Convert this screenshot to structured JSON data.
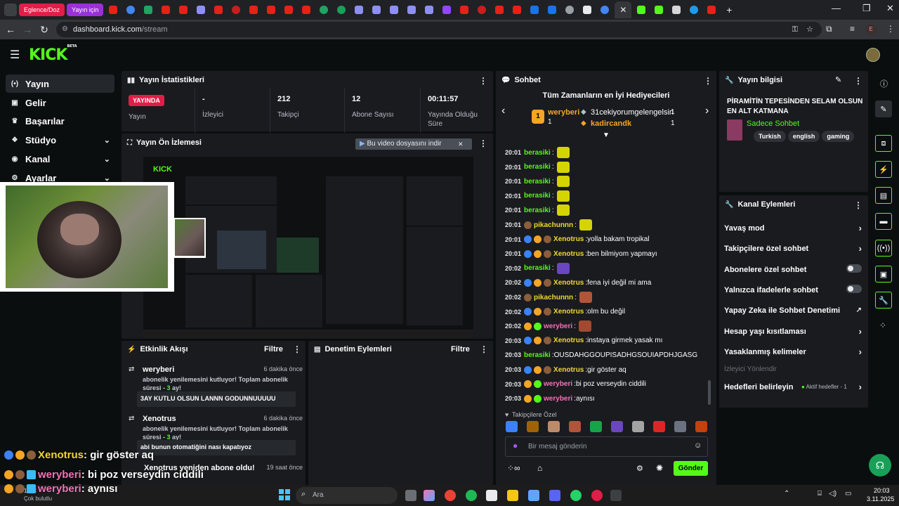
{
  "browser": {
    "tabs": [
      {
        "label": "Eglence/Doz",
        "color": "#e11d48"
      },
      {
        "label": "Yayın için",
        "color": "#9b30d9"
      }
    ],
    "url_host": "dashboard.kick.com",
    "url_path": "/stream",
    "profile_initial": "E"
  },
  "brand": {
    "logo": "KICK",
    "logo_sup": "BETA",
    "accent": "#53fc18"
  },
  "sidebar": {
    "items": [
      {
        "label": "Yayın",
        "icon": "broadcast-icon",
        "glyph": "(•)"
      },
      {
        "label": "Gelir",
        "icon": "revenue-icon",
        "glyph": "▣"
      },
      {
        "label": "Başarılar",
        "icon": "trophy-icon",
        "glyph": "♛"
      },
      {
        "label": "Stüdyo",
        "icon": "studio-icon",
        "glyph": "❖"
      },
      {
        "label": "Kanal",
        "icon": "channel-icon",
        "glyph": "◉"
      },
      {
        "label": "Ayarlar",
        "icon": "settings-icon",
        "glyph": "⚙"
      }
    ]
  },
  "stats": {
    "title": "Yayın İstatistikleri",
    "live_badge": "YAYINDA",
    "live_label": "Yayın",
    "viewers_val": "-",
    "viewers_lbl": "İzleyici",
    "followers_val": "212",
    "followers_lbl": "Takipçi",
    "subs_val": "12",
    "subs_lbl": "Abone Sayısı",
    "uptime_val": "00:11:57",
    "uptime_lbl": "Yayında Olduğu Süre"
  },
  "preview": {
    "title": "Yayın Ön İzlemesi",
    "download_banner": "Bu video dosyasını indir"
  },
  "feed": {
    "title": "Etkinlik Akışı",
    "filter": "Filtre",
    "items": [
      {
        "name": "weryberi",
        "time": "6 dakika önce",
        "msg_a": "abonelik yenilemesini kutluyor! Toplam abonelik süresi - ",
        "msg_num": "3",
        "msg_b": " ay!",
        "quote": "3AY KUTLU OLSUN LANNN GODUNNUUUUU"
      },
      {
        "name": "Xenotrus",
        "time": "6 dakika önce",
        "msg_a": "abonelik yenilemesini kutluyor! Toplam abonelik süresi - ",
        "msg_num": "3",
        "msg_b": " ay!",
        "quote": "abi bunun otomatiğini nası kapatıyoz"
      },
      {
        "name": "Xenotrus yeniden abone oldu!",
        "time": "19 saat önce"
      }
    ]
  },
  "moderation": {
    "title": "Denetim Eylemleri",
    "filter": "Filtre"
  },
  "chat": {
    "title": "Sohbet",
    "gifters_title": "Tüm Zamanların en İyi Hediyecileri",
    "gifters": [
      {
        "rank": "1",
        "name": "weryberi",
        "count": "1"
      },
      {
        "rank": "2",
        "name": "31cekiyorumgelengelsin",
        "count": "1"
      },
      {
        "rank": "3",
        "name": "kadircandk",
        "count": "1"
      }
    ],
    "messages": [
      {
        "time": "20:01",
        "user": "berasiki",
        "color": "#53fc18",
        "text": "",
        "emote": "#d4d400",
        "badges": []
      },
      {
        "time": "20:01",
        "user": "berasiki",
        "color": "#53fc18",
        "text": "",
        "emote": "#d4d400",
        "badges": []
      },
      {
        "time": "20:01",
        "user": "berasiki",
        "color": "#53fc18",
        "text": "",
        "emote": "#d4d400",
        "badges": []
      },
      {
        "time": "20:01",
        "user": "berasiki",
        "color": "#53fc18",
        "text": "",
        "emote": "#d4d400",
        "badges": []
      },
      {
        "time": "20:01",
        "user": "berasiki",
        "color": "#53fc18",
        "text": "",
        "emote": "#d4d400",
        "badges": []
      },
      {
        "time": "20:01",
        "user": "pikachunnn",
        "color": "#f0d832",
        "text": "",
        "emote": "#d4d400",
        "badges": [
          "#8b5e3c"
        ]
      },
      {
        "time": "20:01",
        "user": "Xenotrus",
        "color": "#f0d832",
        "text": "yolla bakam tropikal",
        "emote": "",
        "badges": [
          "#3b82f6",
          "#f5a524",
          "#8b5e3c"
        ]
      },
      {
        "time": "20:01",
        "user": "Xenotrus",
        "color": "#f0d832",
        "text": "ben bilmiyom yapmayı",
        "emote": "",
        "badges": [
          "#3b82f6",
          "#f5a524",
          "#8b5e3c"
        ]
      },
      {
        "time": "20:02",
        "user": "berasiki",
        "color": "#53fc18",
        "text": "",
        "emote": "#6b46c1",
        "badges": []
      },
      {
        "time": "20:02",
        "user": "Xenotrus",
        "color": "#f0d832",
        "text": "fena iyi değil mi ama",
        "emote": "",
        "badges": [
          "#3b82f6",
          "#f5a524",
          "#8b5e3c"
        ]
      },
      {
        "time": "20:02",
        "user": "pikachunnn",
        "color": "#f0d832",
        "text": "",
        "emote": "#b0553a",
        "badges": [
          "#8b5e3c"
        ]
      },
      {
        "time": "20:02",
        "user": "Xenotrus",
        "color": "#f0d832",
        "text": "olm bu değil",
        "emote": "",
        "badges": [
          "#3b82f6",
          "#f5a524",
          "#8b5e3c"
        ]
      },
      {
        "time": "20:02",
        "user": "weryberi",
        "color": "#f472b6",
        "text": "",
        "emote": "#a14a30",
        "badges": [
          "#f5a524",
          "#53fc18"
        ]
      },
      {
        "time": "20:03",
        "user": "Xenotrus",
        "color": "#f0d832",
        "text": "instaya girmek yasak mı",
        "emote": "",
        "badges": [
          "#3b82f6",
          "#f5a524",
          "#8b5e3c"
        ]
      },
      {
        "time": "20:03",
        "user": "berasiki",
        "color": "#53fc18",
        "text": "OUSDAHGGOUPISADHGSOUIAPDHJGASG",
        "emote": "",
        "badges": []
      },
      {
        "time": "20:03",
        "user": "Xenotrus",
        "color": "#f0d832",
        "text": "gir göster aq",
        "emote": "",
        "badges": [
          "#3b82f6",
          "#f5a524",
          "#8b5e3c"
        ]
      },
      {
        "time": "20:03",
        "user": "weryberi",
        "color": "#f472b6",
        "text": "bi poz verseydin ciddili",
        "emote": "",
        "badges": [
          "#f5a524",
          "#53fc18"
        ]
      },
      {
        "time": "20:03",
        "user": "weryberi",
        "color": "#f472b6",
        "text": "aynısı",
        "emote": "",
        "badges": [
          "#f5a524",
          "#53fc18"
        ]
      }
    ],
    "emote_bar_label": "Takipçilere Özel",
    "input_placeholder": "Bir mesaj gönderin",
    "send_label": "Gönder"
  },
  "stream_info": {
    "title": "Yayın bilgisi",
    "stream_title": "PİRAMİTİN TEPESİNDEN SELAM OLSUN EN ALT KATMANA",
    "category": "Sadece Sohbet",
    "tags": [
      "Turkish",
      "english",
      "gaming"
    ]
  },
  "channel_actions": {
    "title": "Kanal Eylemleri",
    "rows": [
      {
        "label": "Yavaş mod",
        "control": "chevron"
      },
      {
        "label": "Takipçilere özel sohbet",
        "control": "chevron"
      },
      {
        "label": "Abonelere özel sohbet",
        "control": "toggle"
      },
      {
        "label": "Yalnızca ifadelerle sohbet",
        "control": "toggle"
      },
      {
        "label": "Yapay Zeka ile Sohbet Denetimi",
        "control": "external"
      },
      {
        "label": "Hesap yaşı kısıtlaması",
        "control": "chevron"
      },
      {
        "label": "Yasaklanmış kelimeler",
        "control": "chevron"
      },
      {
        "label": "İzleyici Yönlendir",
        "control": "none"
      },
      {
        "label": "Hedefleri belirleyin",
        "control": "chevron"
      }
    ],
    "goals_status": "Aktif hedefler - 1"
  },
  "overlay": {
    "lines": [
      {
        "user": "Xenotrus",
        "text": "gir göster aq",
        "color": "#f0d832"
      },
      {
        "user": "weryberi",
        "text": "bi poz verseydin ciddili",
        "color": "#f472b6"
      },
      {
        "user": "weryberi",
        "text": "aynısı",
        "color": "#f472b6"
      }
    ]
  },
  "taskbar": {
    "search_placeholder": "Ara",
    "time": "20:03",
    "date": "3.11.2025",
    "weather_temp": "12°C",
    "weather_text": "Çok bulutlu"
  }
}
